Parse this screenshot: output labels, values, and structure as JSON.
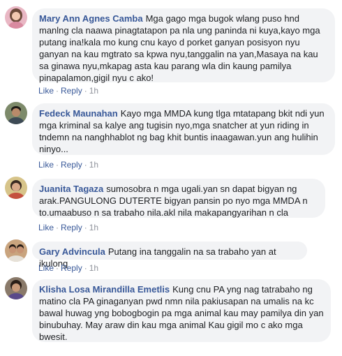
{
  "actions": {
    "like": "Like",
    "reply": "Reply",
    "separator": "·"
  },
  "comments": [
    {
      "author": "Mary Ann Agnes Camba",
      "text": "Mga gago mga bugok wlang puso hnd manlng cla naawa pinagtatapon pa nla ung paninda ni kuya,kayo mga putang ina!kala mo kung cnu kayo d porket ganyan posisyon nyu ganyan na kau mgtrato sa kpwa nyu,tanggalin na yan,Masaya na kau sa ginawa nyu,mkapag asta kau parang wla din kaung pamilya pinapalamon,gigil nyu c ako!",
      "time": "1h",
      "avatar": {
        "bg": "#e9b7c4",
        "skin": "#f2c8b0",
        "hair": "#6b4a3a"
      }
    },
    {
      "author": "Fedeck Maunahan",
      "text": "Kayo mga MMDA kung tlga mtatapang bkit ndi yun mga kriminal sa kalye ang tugisin nyo,mga snatcher at yun riding in tndemn na nanghhablot ng bag khit buntis inaagawan.yun ang hulihin ninyo...",
      "time": "1h",
      "avatar": {
        "bg": "#7d8a6a",
        "skin": "#b88a6a",
        "hair": "#1e1a16"
      }
    },
    {
      "author": "Juanita Tagaza",
      "text": "sumosobra n mga ugali.yan sn dapat bigyan ng arak.PANGULONG DUTERTE bigyan pansin po nyo mga MMDA n to.umaabuso n sa trabaho nila.akl nila makapangyarihan n cla",
      "time": "1h",
      "avatar": {
        "bg": "#d7c48a",
        "skin": "#d9a98a",
        "hair": "#3a2a22"
      }
    },
    {
      "author": "Gary Advincula",
      "text": "Putang ina tanggalin na sa trabaho yan at ikulong",
      "time": "1h",
      "avatar": {
        "bg": "#c9a47e",
        "skin": "#c79474",
        "hair": "#231a15"
      }
    },
    {
      "author": "Klisha Losa Mirandilla Emetlis",
      "text": "Kung cnu PA yng nag tatrabaho ng matino cla PA ginaganyan pwd nmn nila pakiusapan na umalis na kc bawal huwag yng bobogbogin pa mga animal kau may pamilya din yan binubuhay. May araw din kau mga animal Kau gigil mo c ako mga bwesit.",
      "time": "1h",
      "avatar": {
        "bg": "#8a7a6a",
        "skin": "#c99a7a",
        "hair": "#2a1e18"
      }
    }
  ]
}
